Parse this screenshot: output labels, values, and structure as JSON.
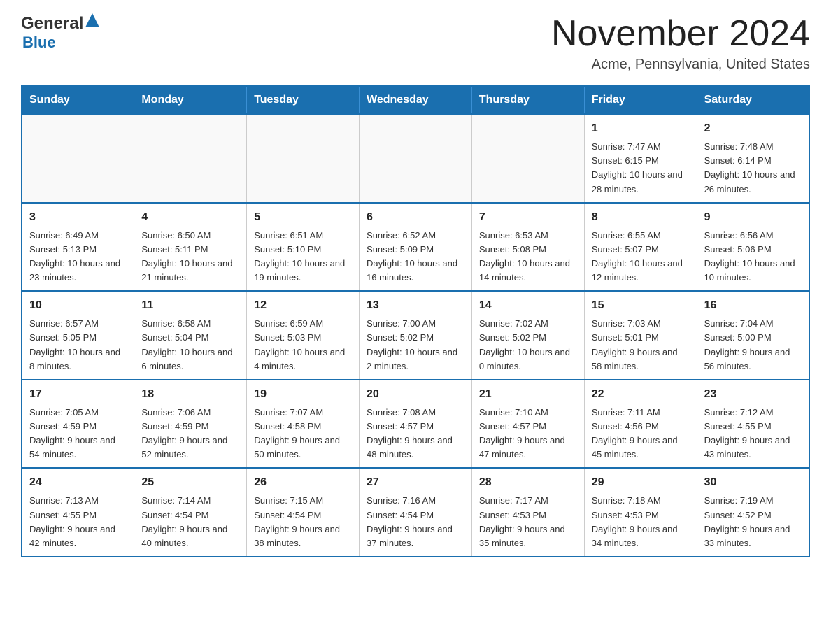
{
  "logo": {
    "general": "General",
    "blue": "Blue"
  },
  "header": {
    "month": "November 2024",
    "location": "Acme, Pennsylvania, United States"
  },
  "weekdays": [
    "Sunday",
    "Monday",
    "Tuesday",
    "Wednesday",
    "Thursday",
    "Friday",
    "Saturday"
  ],
  "weeks": [
    [
      {
        "day": "",
        "info": ""
      },
      {
        "day": "",
        "info": ""
      },
      {
        "day": "",
        "info": ""
      },
      {
        "day": "",
        "info": ""
      },
      {
        "day": "",
        "info": ""
      },
      {
        "day": "1",
        "info": "Sunrise: 7:47 AM\nSunset: 6:15 PM\nDaylight: 10 hours and 28 minutes."
      },
      {
        "day": "2",
        "info": "Sunrise: 7:48 AM\nSunset: 6:14 PM\nDaylight: 10 hours and 26 minutes."
      }
    ],
    [
      {
        "day": "3",
        "info": "Sunrise: 6:49 AM\nSunset: 5:13 PM\nDaylight: 10 hours and 23 minutes."
      },
      {
        "day": "4",
        "info": "Sunrise: 6:50 AM\nSunset: 5:11 PM\nDaylight: 10 hours and 21 minutes."
      },
      {
        "day": "5",
        "info": "Sunrise: 6:51 AM\nSunset: 5:10 PM\nDaylight: 10 hours and 19 minutes."
      },
      {
        "day": "6",
        "info": "Sunrise: 6:52 AM\nSunset: 5:09 PM\nDaylight: 10 hours and 16 minutes."
      },
      {
        "day": "7",
        "info": "Sunrise: 6:53 AM\nSunset: 5:08 PM\nDaylight: 10 hours and 14 minutes."
      },
      {
        "day": "8",
        "info": "Sunrise: 6:55 AM\nSunset: 5:07 PM\nDaylight: 10 hours and 12 minutes."
      },
      {
        "day": "9",
        "info": "Sunrise: 6:56 AM\nSunset: 5:06 PM\nDaylight: 10 hours and 10 minutes."
      }
    ],
    [
      {
        "day": "10",
        "info": "Sunrise: 6:57 AM\nSunset: 5:05 PM\nDaylight: 10 hours and 8 minutes."
      },
      {
        "day": "11",
        "info": "Sunrise: 6:58 AM\nSunset: 5:04 PM\nDaylight: 10 hours and 6 minutes."
      },
      {
        "day": "12",
        "info": "Sunrise: 6:59 AM\nSunset: 5:03 PM\nDaylight: 10 hours and 4 minutes."
      },
      {
        "day": "13",
        "info": "Sunrise: 7:00 AM\nSunset: 5:02 PM\nDaylight: 10 hours and 2 minutes."
      },
      {
        "day": "14",
        "info": "Sunrise: 7:02 AM\nSunset: 5:02 PM\nDaylight: 10 hours and 0 minutes."
      },
      {
        "day": "15",
        "info": "Sunrise: 7:03 AM\nSunset: 5:01 PM\nDaylight: 9 hours and 58 minutes."
      },
      {
        "day": "16",
        "info": "Sunrise: 7:04 AM\nSunset: 5:00 PM\nDaylight: 9 hours and 56 minutes."
      }
    ],
    [
      {
        "day": "17",
        "info": "Sunrise: 7:05 AM\nSunset: 4:59 PM\nDaylight: 9 hours and 54 minutes."
      },
      {
        "day": "18",
        "info": "Sunrise: 7:06 AM\nSunset: 4:59 PM\nDaylight: 9 hours and 52 minutes."
      },
      {
        "day": "19",
        "info": "Sunrise: 7:07 AM\nSunset: 4:58 PM\nDaylight: 9 hours and 50 minutes."
      },
      {
        "day": "20",
        "info": "Sunrise: 7:08 AM\nSunset: 4:57 PM\nDaylight: 9 hours and 48 minutes."
      },
      {
        "day": "21",
        "info": "Sunrise: 7:10 AM\nSunset: 4:57 PM\nDaylight: 9 hours and 47 minutes."
      },
      {
        "day": "22",
        "info": "Sunrise: 7:11 AM\nSunset: 4:56 PM\nDaylight: 9 hours and 45 minutes."
      },
      {
        "day": "23",
        "info": "Sunrise: 7:12 AM\nSunset: 4:55 PM\nDaylight: 9 hours and 43 minutes."
      }
    ],
    [
      {
        "day": "24",
        "info": "Sunrise: 7:13 AM\nSunset: 4:55 PM\nDaylight: 9 hours and 42 minutes."
      },
      {
        "day": "25",
        "info": "Sunrise: 7:14 AM\nSunset: 4:54 PM\nDaylight: 9 hours and 40 minutes."
      },
      {
        "day": "26",
        "info": "Sunrise: 7:15 AM\nSunset: 4:54 PM\nDaylight: 9 hours and 38 minutes."
      },
      {
        "day": "27",
        "info": "Sunrise: 7:16 AM\nSunset: 4:54 PM\nDaylight: 9 hours and 37 minutes."
      },
      {
        "day": "28",
        "info": "Sunrise: 7:17 AM\nSunset: 4:53 PM\nDaylight: 9 hours and 35 minutes."
      },
      {
        "day": "29",
        "info": "Sunrise: 7:18 AM\nSunset: 4:53 PM\nDaylight: 9 hours and 34 minutes."
      },
      {
        "day": "30",
        "info": "Sunrise: 7:19 AM\nSunset: 4:52 PM\nDaylight: 9 hours and 33 minutes."
      }
    ]
  ]
}
